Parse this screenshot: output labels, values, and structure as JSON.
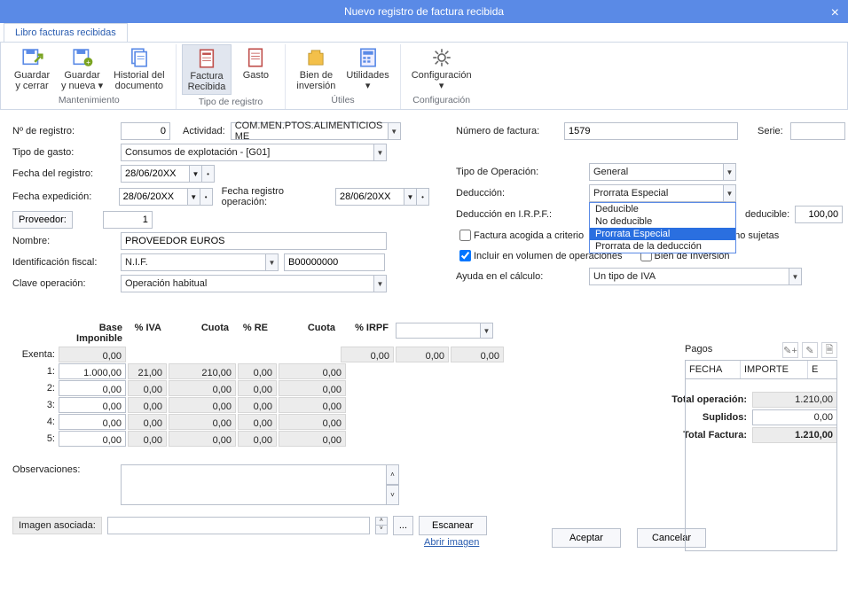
{
  "title": "Nuevo registro de factura recibida",
  "tab": "Libro facturas recibidas",
  "ribbon": {
    "groups": [
      {
        "name": "Mantenimiento",
        "items": [
          {
            "key": "guardar-cerrar",
            "label": "Guardar\ny cerrar"
          },
          {
            "key": "guardar-nueva",
            "label": "Guardar\ny nueva ▾"
          },
          {
            "key": "historial",
            "label": "Historial del\ndocumento"
          }
        ]
      },
      {
        "name": "Tipo de registro",
        "items": [
          {
            "key": "factura-recibida",
            "label": "Factura\nRecibida",
            "active": true
          },
          {
            "key": "gasto",
            "label": "Gasto"
          }
        ]
      },
      {
        "name": "Útiles",
        "items": [
          {
            "key": "bien-inversion",
            "label": "Bien de\ninversión"
          },
          {
            "key": "utilidades",
            "label": "Utilidades\n▾"
          }
        ]
      },
      {
        "name": "Configuración",
        "items": [
          {
            "key": "configuracion",
            "label": "Configuración\n▾"
          }
        ]
      }
    ]
  },
  "labels": {
    "n_registro": "Nº de registro:",
    "actividad": "Actividad:",
    "tipo_gasto": "Tipo de gasto:",
    "fecha_registro": "Fecha del registro:",
    "fecha_expedicion": "Fecha expedición:",
    "fecha_reg_op": "Fecha registro operación:",
    "proveedor_btn": "Proveedor:",
    "nombre": "Nombre:",
    "ident_fiscal": "Identificación fiscal:",
    "clave_op": "Clave operación:",
    "num_factura": "Número de factura:",
    "serie": "Serie:",
    "tipo_operacion": "Tipo de Operación:",
    "deduccion": "Deducción:",
    "ded_irpf": "Deducción en I.R.P.F.:",
    "factura_cc": "Factura acogida a criterio",
    "no_sujetas": "no sujetas",
    "incluir_vol": "Incluir en  volumen de operaciones",
    "bien_inv": "Bien de Inversión",
    "ayuda_calc": "Ayuda en el cálculo:",
    "pct_deducible": "deducible:",
    "observaciones": "Observaciones:",
    "imagen_asoc": "Imagen asociada:",
    "escanear": "Escanear",
    "abrir_img": "Abrir imagen",
    "aceptar": "Aceptar",
    "cancelar": "Cancelar",
    "browse": "..."
  },
  "values": {
    "n_registro": "0",
    "actividad": "COM.MEN.PTOS.ALIMENTICIOS ME",
    "tipo_gasto": "Consumos de explotación - [G01]",
    "fecha_registro": "28/06/20XX",
    "fecha_expedicion": "28/06/20XX",
    "fecha_reg_op": "28/06/20XX",
    "proveedor": "1",
    "nombre": "PROVEEDOR EUROS",
    "ident_tipo": "N.I.F.",
    "ident_num": "B00000000",
    "clave_op": "Operación habitual",
    "num_factura": "1579",
    "serie": "",
    "tipo_operacion": "General",
    "deduccion": "Prorrata Especial",
    "pct_deducible": "100,00",
    "ayuda_calc": "Un tipo de IVA",
    "incluir_vol": true,
    "factura_cc": false,
    "bien_inv": false
  },
  "deduccion_options": [
    "Deducible",
    "No deducible",
    "Prorrata Especial",
    "Prorrata de la deducción"
  ],
  "iva": {
    "headers": {
      "base": "Base Imponible",
      "piva": "% IVA",
      "cuota": "Cuota",
      "pre": "% RE",
      "cuota2": "Cuota",
      "pirpf": "% IRPF"
    },
    "exenta_label": "Exenta:",
    "exenta": "0,00",
    "rows": [
      {
        "n": "1:",
        "base": "1.000,00",
        "piva": "21,00",
        "cuota": "210,00",
        "pre": "0,00",
        "cuota2": "0,00"
      },
      {
        "n": "2:",
        "base": "0,00",
        "piva": "0,00",
        "cuota": "0,00",
        "pre": "0,00",
        "cuota2": "0,00"
      },
      {
        "n": "3:",
        "base": "0,00",
        "piva": "0,00",
        "cuota": "0,00",
        "pre": "0,00",
        "cuota2": "0,00"
      },
      {
        "n": "4:",
        "base": "0,00",
        "piva": "0,00",
        "cuota": "0,00",
        "pre": "0,00",
        "cuota2": "0,00"
      },
      {
        "n": "5:",
        "base": "0,00",
        "piva": "0,00",
        "cuota": "0,00",
        "pre": "0,00",
        "cuota2": "0,00"
      }
    ],
    "irpf_row": {
      "v1": "0,00",
      "v2": "0,00",
      "v3": "0,00"
    }
  },
  "totals": {
    "total_op_label": "Total operación:",
    "total_op": "1.210,00",
    "suplidos_label": "Suplidos:",
    "suplidos": "0,00",
    "total_fac_label": "Total Factura:",
    "total_fac": "1.210,00"
  },
  "pagos": {
    "title": "Pagos",
    "cols": {
      "fecha": "FECHA",
      "importe": "IMPORTE",
      "e": "E"
    }
  }
}
